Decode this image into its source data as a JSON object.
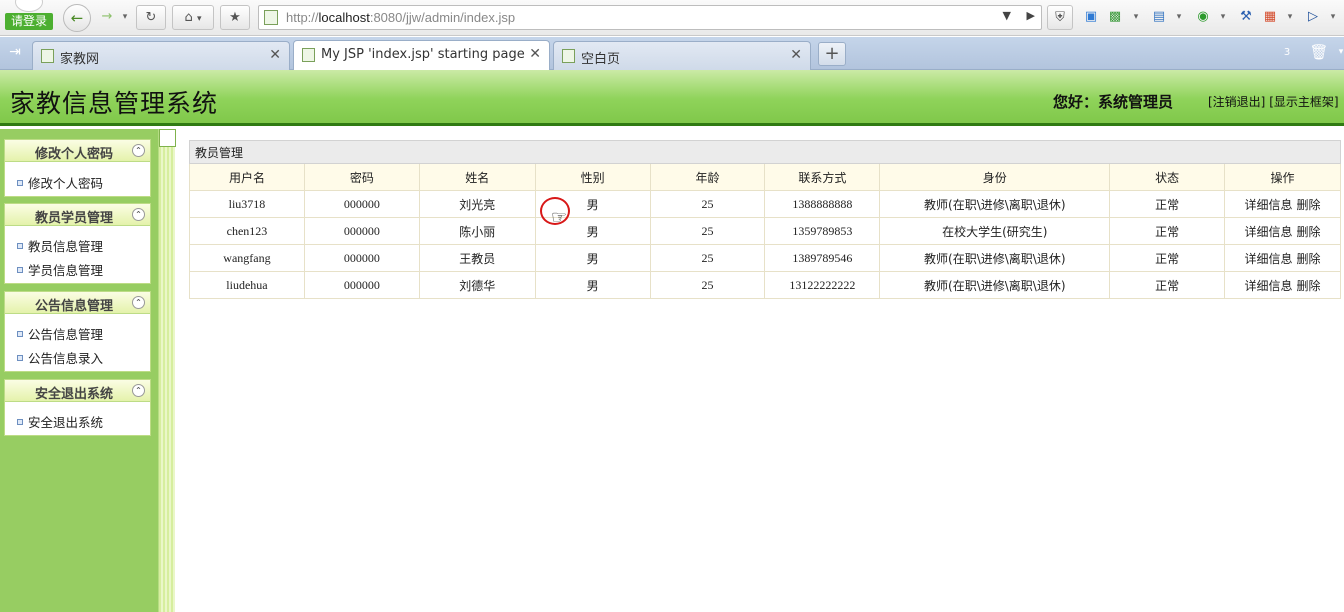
{
  "browser": {
    "login_label": "请登录",
    "url_prefix": "http://",
    "url_host": "localhost",
    "url_rest": ":8080/jjw/admin/index.jsp",
    "tabs": [
      {
        "title": "家教网",
        "active": false
      },
      {
        "title": "My JSP 'index.jsp' starting page",
        "active": true
      },
      {
        "title": "空白页",
        "active": false
      }
    ],
    "closed_tab_count": "3"
  },
  "header": {
    "title": "家教信息管理系统",
    "greeting": "您好：系统管理员",
    "logout_link": "[注销退出]",
    "frame_link": "[显示主框架]"
  },
  "sidebar": {
    "sections": [
      {
        "title": "修改个人密码",
        "items": [
          "修改个人密码"
        ]
      },
      {
        "title": "教员学员管理",
        "items": [
          "教员信息管理",
          "学员信息管理"
        ]
      },
      {
        "title": "公告信息管理",
        "items": [
          "公告信息管理",
          "公告信息录入"
        ]
      },
      {
        "title": "安全退出系统",
        "items": [
          "安全退出系统"
        ]
      }
    ]
  },
  "table": {
    "caption": "教员管理",
    "columns": [
      "用户名",
      "密码",
      "姓名",
      "性别",
      "年龄",
      "联系方式",
      "身份",
      "状态",
      "操作"
    ],
    "rows": [
      {
        "username": "liu3718",
        "password": "000000",
        "name": "刘光亮",
        "gender": "男",
        "age": "25",
        "phone": "1388888888",
        "identity": "教师(在职\\进修\\离职\\退休)",
        "status": "正常"
      },
      {
        "username": "chen123",
        "password": "000000",
        "name": "陈小丽",
        "gender": "男",
        "age": "25",
        "phone": "1359789853",
        "identity": "在校大学生(研究生)",
        "status": "正常"
      },
      {
        "username": "wangfang",
        "password": "000000",
        "name": "王教员",
        "gender": "男",
        "age": "25",
        "phone": "1389789546",
        "identity": "教师(在职\\进修\\离职\\退休)",
        "status": "正常"
      },
      {
        "username": "liudehua",
        "password": "000000",
        "name": "刘德华",
        "gender": "男",
        "age": "25",
        "phone": "13122222222",
        "identity": "教师(在职\\进修\\离职\\退休)",
        "status": "正常"
      }
    ],
    "action_detail": "详细信息",
    "action_delete": "删除"
  }
}
